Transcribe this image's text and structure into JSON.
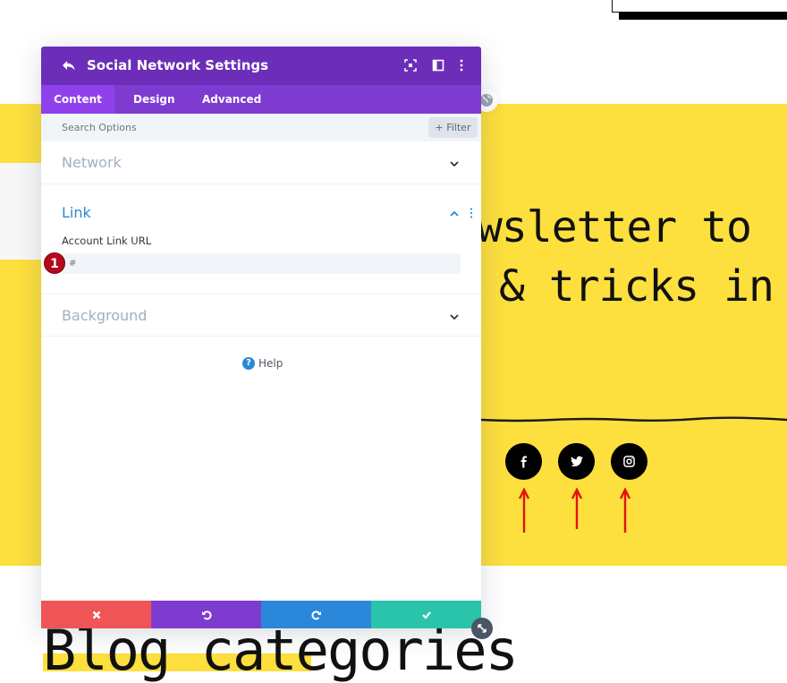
{
  "background_page": {
    "hero_line_1": "wsletter to",
    "hero_line_2": "& tricks in",
    "blog_heading": "Blog categories",
    "social_icons": [
      {
        "name": "facebook",
        "glyph": "f"
      },
      {
        "name": "twitter",
        "glyph": "t"
      },
      {
        "name": "instagram",
        "glyph": "ig"
      }
    ],
    "colors": {
      "yellow": "#fddf3e",
      "arrow": "#e0140c"
    }
  },
  "panel": {
    "title": "Social Network Settings",
    "header_icons": [
      "back-icon",
      "focus-icon",
      "split-view-icon",
      "more-options-icon"
    ],
    "tabs": [
      {
        "label": "Content",
        "active": true
      },
      {
        "label": "Design",
        "active": false
      },
      {
        "label": "Advanced",
        "active": false
      }
    ],
    "search": {
      "placeholder": "Search Options",
      "filter_label": "+ Filter"
    },
    "sections": [
      {
        "title": "Network",
        "expanded": false
      },
      {
        "title": "Link",
        "expanded": true,
        "fields": [
          {
            "label": "Account Link URL",
            "placeholder": "#",
            "value": ""
          }
        ]
      },
      {
        "title": "Background",
        "expanded": false
      }
    ],
    "badge_number": "1",
    "help_label": "Help",
    "footer_buttons": [
      "cancel",
      "undo",
      "redo",
      "save"
    ],
    "colors": {
      "header": "#6c2eb9",
      "tabs": "#7e3bd0",
      "tab_active": "#8f42ec",
      "cancel": "#ef5555",
      "undo": "#7e3bd0",
      "redo": "#2b87da",
      "save": "#29c4a9",
      "active_section": "#2b87da"
    }
  }
}
